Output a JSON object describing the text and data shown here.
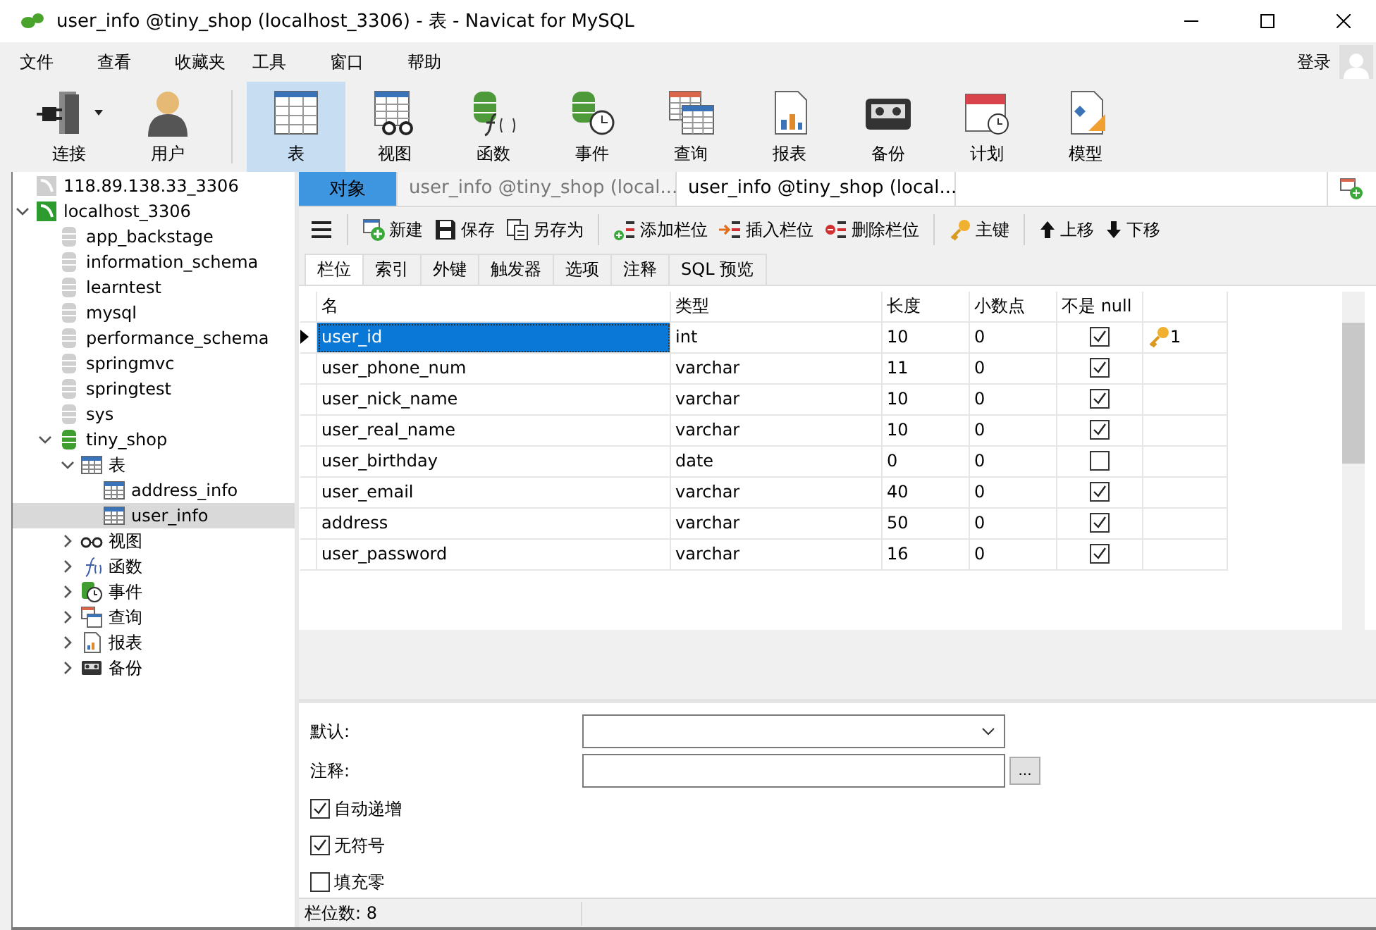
{
  "window": {
    "title": "user_info @tiny_shop (localhost_3306) - 表 - Navicat for MySQL"
  },
  "menu": [
    "文件",
    "查看",
    "收藏夹",
    "工具",
    "窗口",
    "帮助"
  ],
  "login": "登录",
  "toolbar": [
    {
      "label": "连接",
      "kind": "connection",
      "selected": false
    },
    {
      "label": "用户",
      "kind": "user",
      "selected": false
    },
    {
      "label": "表",
      "kind": "table",
      "selected": true
    },
    {
      "label": "视图",
      "kind": "view",
      "selected": false
    },
    {
      "label": "函数",
      "kind": "function",
      "selected": false
    },
    {
      "label": "事件",
      "kind": "event",
      "selected": false
    },
    {
      "label": "查询",
      "kind": "query",
      "selected": false
    },
    {
      "label": "报表",
      "kind": "report",
      "selected": false
    },
    {
      "label": "备份",
      "kind": "backup",
      "selected": false
    },
    {
      "label": "计划",
      "kind": "schedule",
      "selected": false
    },
    {
      "label": "模型",
      "kind": "model",
      "selected": false
    }
  ],
  "tree": [
    {
      "label": "118.89.138.33_3306",
      "kind": "connection",
      "open": false,
      "selected": false
    },
    {
      "label": "localhost_3306",
      "kind": "connection",
      "open": true,
      "expanded": true,
      "selected": false,
      "children": [
        {
          "label": "app_backstage",
          "kind": "database",
          "open": false,
          "selected": false
        },
        {
          "label": "information_schema",
          "kind": "database",
          "open": false,
          "selected": false
        },
        {
          "label": "learntest",
          "kind": "database",
          "open": false,
          "selected": false
        },
        {
          "label": "mysql",
          "kind": "database",
          "open": false,
          "selected": false
        },
        {
          "label": "performance_schema",
          "kind": "database",
          "open": false,
          "selected": false
        },
        {
          "label": "springmvc",
          "kind": "database",
          "open": false,
          "selected": false
        },
        {
          "label": "springtest",
          "kind": "database",
          "open": false,
          "selected": false
        },
        {
          "label": "sys",
          "kind": "database",
          "open": false,
          "selected": false
        },
        {
          "label": "tiny_shop",
          "kind": "database",
          "open": true,
          "expanded": true,
          "selected": false,
          "children": [
            {
              "label": "表",
              "kind": "table",
              "expanded": true,
              "selected": false,
              "children": [
                {
                  "label": "address_info",
                  "kind": "table",
                  "selected": false
                },
                {
                  "label": "user_info",
                  "kind": "table",
                  "selected": true
                }
              ]
            },
            {
              "label": "视图",
              "kind": "view",
              "expanded": false,
              "selected": false
            },
            {
              "label": "函数",
              "kind": "function",
              "expanded": false,
              "selected": false
            },
            {
              "label": "事件",
              "kind": "event",
              "expanded": false,
              "selected": false
            },
            {
              "label": "查询",
              "kind": "query",
              "expanded": false,
              "selected": false
            },
            {
              "label": "报表",
              "kind": "report",
              "expanded": false,
              "selected": false
            },
            {
              "label": "备份",
              "kind": "backup",
              "expanded": false,
              "selected": false
            }
          ]
        }
      ]
    }
  ],
  "doc_tabs": [
    {
      "label": "对象",
      "kind": "objects",
      "selected": false
    },
    {
      "label": "user_info @tiny_shop (local...",
      "kind": "table",
      "selected": false
    },
    {
      "label": "user_info @tiny_shop (local...",
      "kind": "design",
      "selected": true
    }
  ],
  "actions": [
    {
      "label": "新建",
      "kind": "new"
    },
    {
      "label": "保存",
      "kind": "save"
    },
    {
      "label": "另存为",
      "kind": "save-as"
    },
    {
      "label": "添加栏位",
      "kind": "add"
    },
    {
      "label": "插入栏位",
      "kind": "insert"
    },
    {
      "label": "删除栏位",
      "kind": "delete"
    },
    {
      "label": "主键",
      "kind": "key"
    },
    {
      "label": "上移",
      "kind": "up"
    },
    {
      "label": "下移",
      "kind": "down"
    }
  ],
  "sub_tabs": [
    {
      "label": "栏位",
      "selected": true
    },
    {
      "label": "索引",
      "selected": false
    },
    {
      "label": "外键",
      "selected": false
    },
    {
      "label": "触发器",
      "selected": false
    },
    {
      "label": "选项",
      "selected": false
    },
    {
      "label": "注释",
      "selected": false
    },
    {
      "label": "SQL 预览",
      "selected": false
    }
  ],
  "table": {
    "columns": [
      "名",
      "类型",
      "长度",
      "小数点",
      "不是 null"
    ],
    "rows": [
      {
        "name": "user_id",
        "type": "int",
        "length": "10",
        "decimals": "0",
        "not_null": true,
        "key": "1",
        "selected": true
      },
      {
        "name": "user_phone_num",
        "type": "varchar",
        "length": "11",
        "decimals": "0",
        "not_null": true,
        "selected": false
      },
      {
        "name": "user_nick_name",
        "type": "varchar",
        "length": "10",
        "decimals": "0",
        "not_null": true,
        "selected": false
      },
      {
        "name": "user_real_name",
        "type": "varchar",
        "length": "10",
        "decimals": "0",
        "not_null": true,
        "selected": false
      },
      {
        "name": "user_birthday",
        "type": "date",
        "length": "0",
        "decimals": "0",
        "not_null": false,
        "selected": false
      },
      {
        "name": "user_email",
        "type": "varchar",
        "length": "40",
        "decimals": "0",
        "not_null": true,
        "selected": false
      },
      {
        "name": "address",
        "type": "varchar",
        "length": "50",
        "decimals": "0",
        "not_null": true,
        "selected": false
      },
      {
        "name": "user_password",
        "type": "varchar",
        "length": "16",
        "decimals": "0",
        "not_null": true,
        "selected": false
      }
    ]
  },
  "form": {
    "default_label": "默认:",
    "comment_label": "注释:",
    "browse_button": "...",
    "options": [
      {
        "label": "自动递增",
        "checked": true
      },
      {
        "label": "无符号",
        "checked": true
      },
      {
        "label": "填充零",
        "checked": false
      }
    ]
  },
  "status_bar": "栏位数: 8"
}
